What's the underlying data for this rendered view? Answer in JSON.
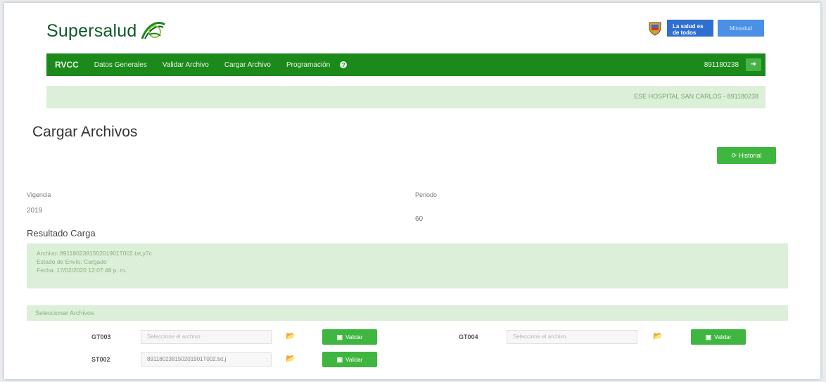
{
  "header": {
    "logo_text": "Supersalud",
    "badge_salud": "La salud es de todos",
    "badge_ministry": "Minsalud"
  },
  "nav": {
    "brand": "RVCC",
    "items": [
      "Datos Generales",
      "Validar Archivo",
      "Cargar Archivo",
      "Programación"
    ],
    "user": "891180238",
    "help_icon": "question-circle-icon",
    "logout_icon": "sign-out-icon"
  },
  "infobar": {
    "entity": "ESE HOSPITAL SAN CARLOS - 891180238"
  },
  "page": {
    "title": "Cargar Archivos",
    "history_button": "Historial",
    "vigencia_label": "Vigencia",
    "vigencia_value": "2019",
    "periodo_label": "Periodo",
    "periodo_value": "60"
  },
  "result": {
    "section_title": "Resultado Carga",
    "line1": "Archivo: 891180238150201901T002.txt,y7c",
    "line2": "Estado de Envío: Cargado",
    "line3": "Fecha: 17/02/2020 12:07:48 p. m."
  },
  "select": {
    "title": "Seleccionar Archivos",
    "placeholder": "Seleccione el archivo",
    "validate_label": "Validar",
    "rows": [
      {
        "code": "GT003",
        "value": ""
      },
      {
        "code": "GT004",
        "value": ""
      },
      {
        "code": "ST002",
        "value": "891180238150201901T002.txt,j"
      }
    ]
  },
  "colors": {
    "nav_green": "#1b8a1b",
    "button_green": "#3fb63f",
    "info_bg": "#dcefd8",
    "brand_blue": "#2f6fd1"
  }
}
